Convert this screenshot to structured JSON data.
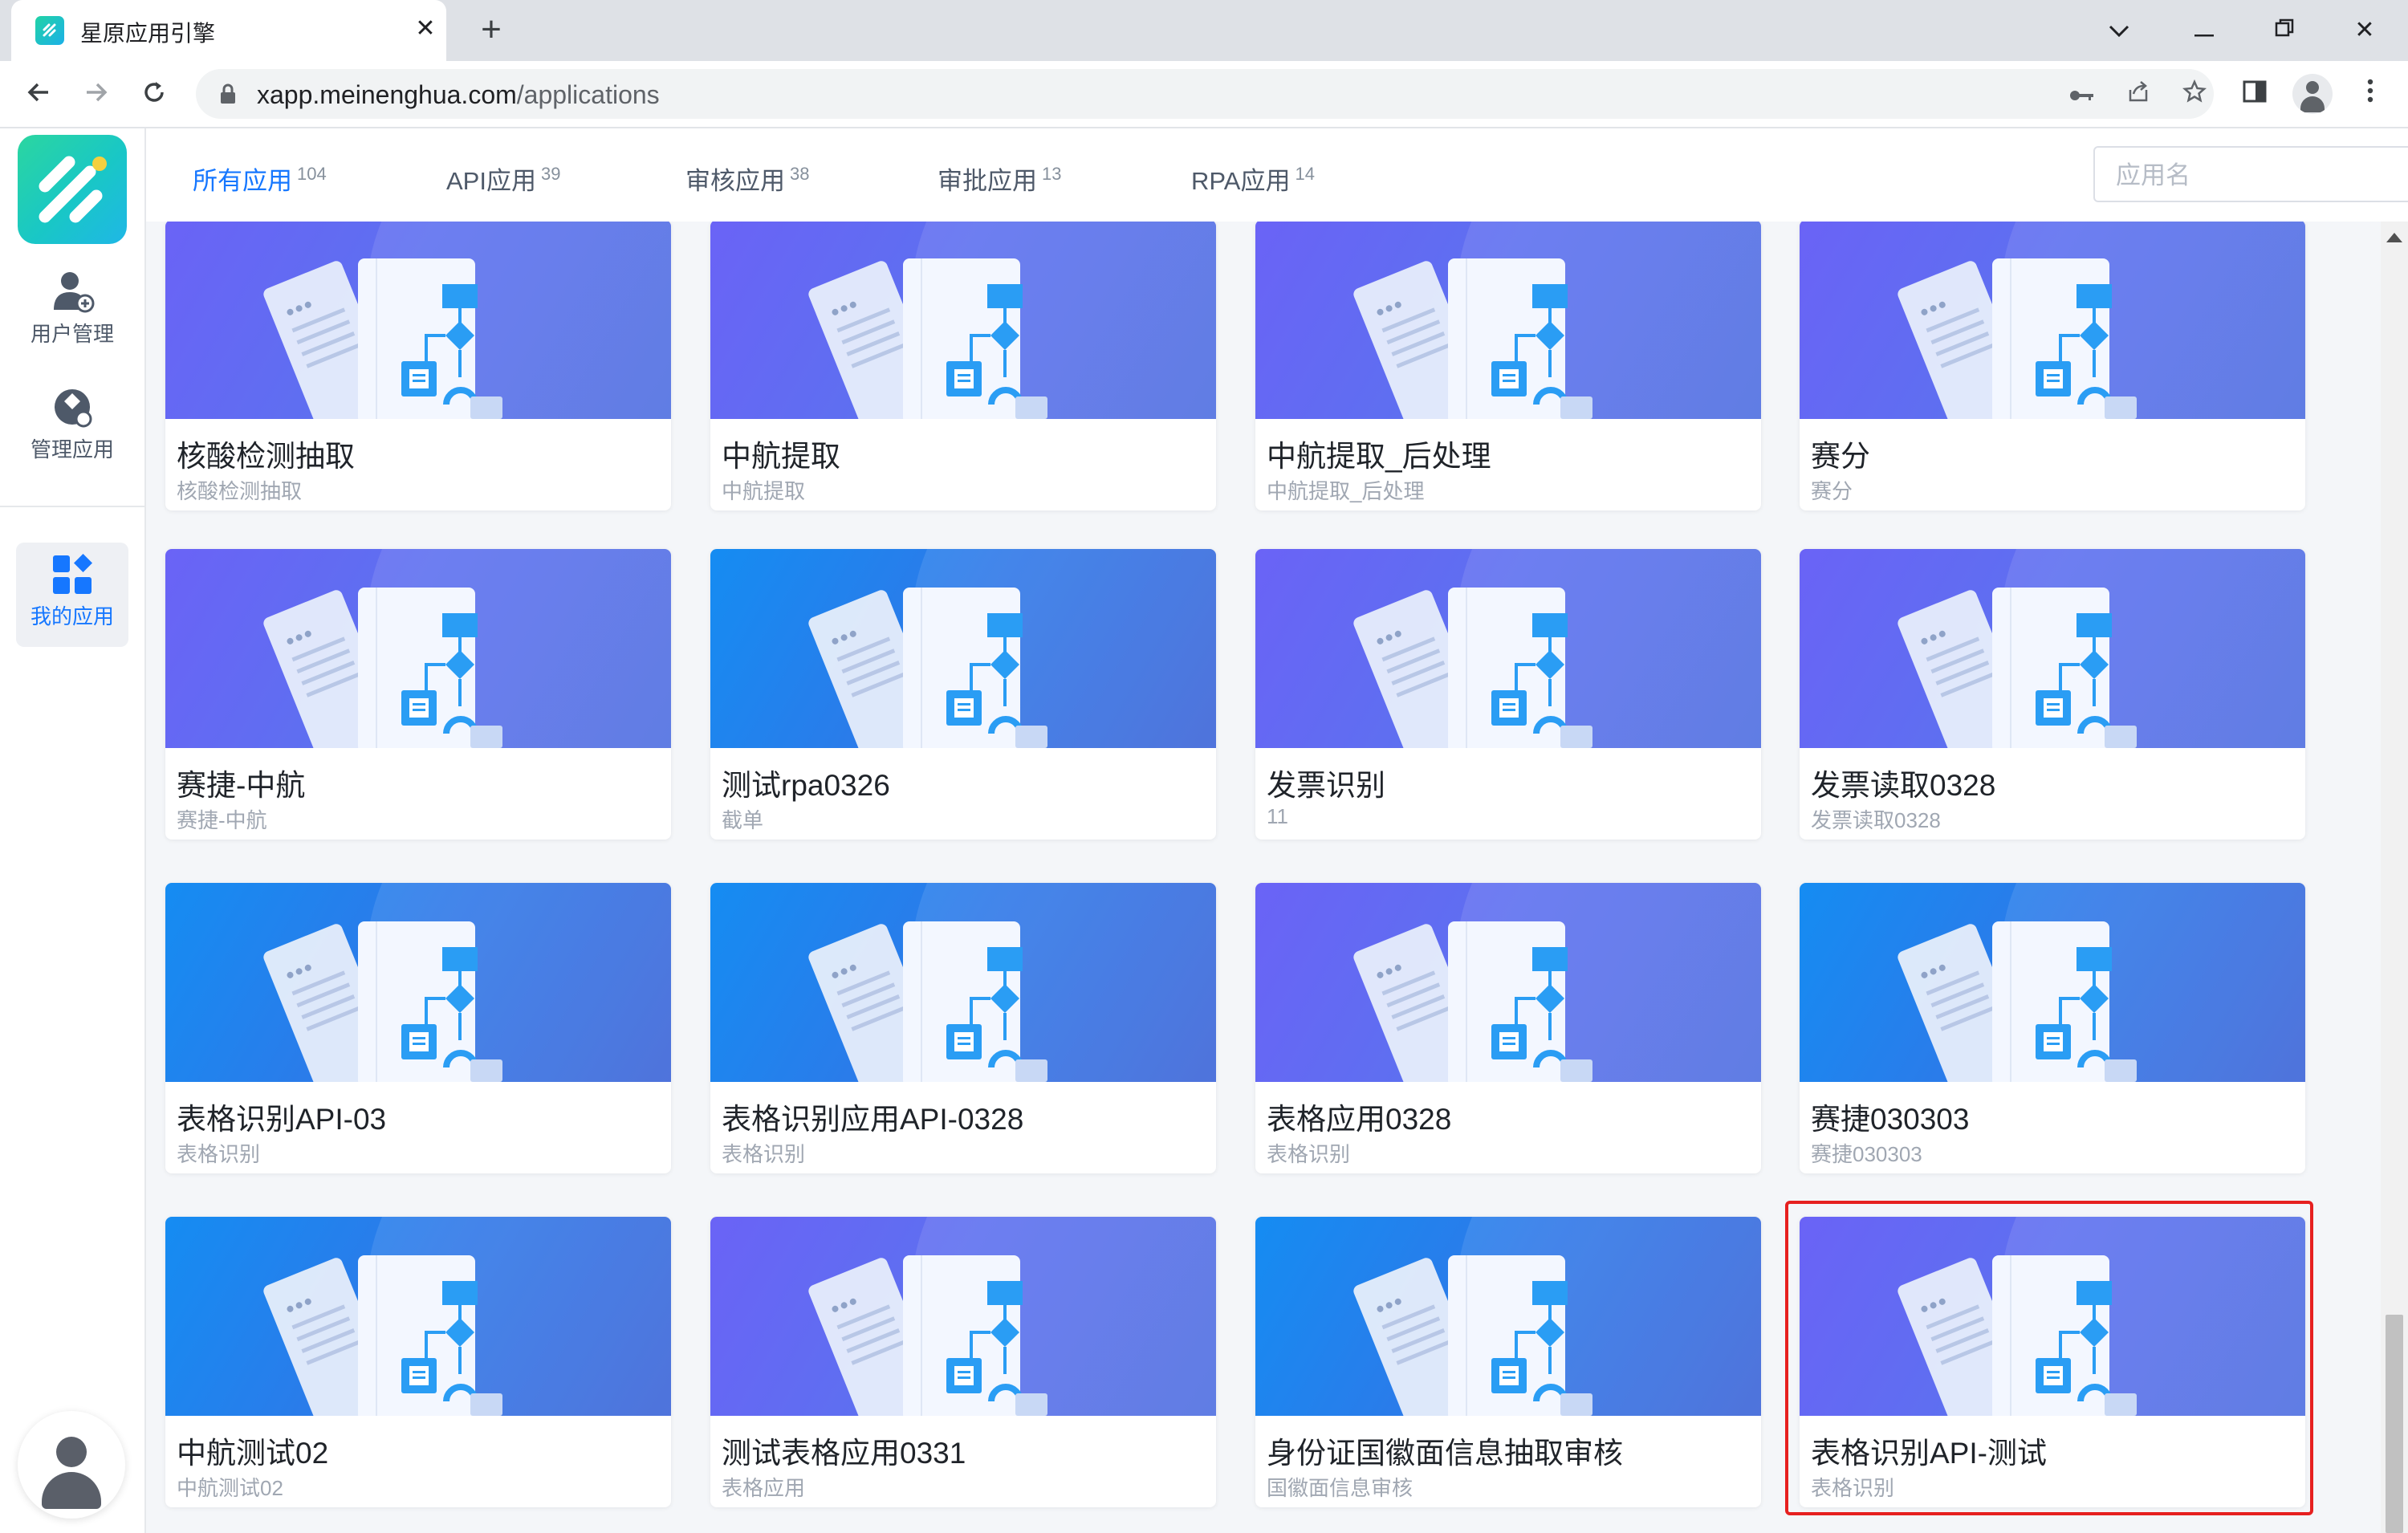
{
  "browser": {
    "tab_title": "星原应用引擎",
    "url_domain": "xapp.meinenghua.com",
    "url_path": "/applications"
  },
  "sidebar": {
    "items": [
      {
        "label": "用户管理",
        "icon": "user-manage-icon"
      },
      {
        "label": "管理应用",
        "icon": "manage-app-icon"
      },
      {
        "label": "我的应用",
        "icon": "my-apps-icon"
      }
    ],
    "active_index": 2,
    "accent": "#1677ff"
  },
  "filters": {
    "tabs": [
      {
        "label": "所有应用",
        "count": "104"
      },
      {
        "label": "API应用",
        "count": "39"
      },
      {
        "label": "审核应用",
        "count": "38"
      },
      {
        "label": "审批应用",
        "count": "13"
      },
      {
        "label": "RPA应用",
        "count": "14"
      }
    ],
    "active_index": 0,
    "search_placeholder": "应用名"
  },
  "apps": [
    {
      "title": "核酸检测抽取",
      "desc": "核酸检测抽取",
      "theme": "purple"
    },
    {
      "title": "中航提取",
      "desc": "中航提取",
      "theme": "purple"
    },
    {
      "title": "中航提取_后处理",
      "desc": "中航提取_后处理",
      "theme": "purple"
    },
    {
      "title": "赛分",
      "desc": "赛分",
      "theme": "purple"
    },
    {
      "title": "赛捷-中航",
      "desc": "赛捷-中航",
      "theme": "purple"
    },
    {
      "title": "测试rpa0326",
      "desc": "截单",
      "theme": "blue"
    },
    {
      "title": "发票识别",
      "desc": "11",
      "theme": "purple"
    },
    {
      "title": "发票读取0328",
      "desc": "发票读取0328",
      "theme": "purple"
    },
    {
      "title": "表格识别API-03",
      "desc": "表格识别",
      "theme": "blue"
    },
    {
      "title": "表格识别应用API-0328",
      "desc": "表格识别",
      "theme": "blue"
    },
    {
      "title": "表格应用0328",
      "desc": "表格识别",
      "theme": "purple"
    },
    {
      "title": "赛捷030303",
      "desc": "赛捷030303",
      "theme": "blue"
    },
    {
      "title": "中航测试02",
      "desc": "中航测试02",
      "theme": "blue"
    },
    {
      "title": "测试表格应用0331",
      "desc": "表格应用",
      "theme": "purple"
    },
    {
      "title": "身份证国徽面信息抽取审核",
      "desc": "国徽面信息审核",
      "theme": "blue"
    },
    {
      "title": "表格识别API-测试",
      "desc": "表格识别",
      "theme": "purple"
    }
  ],
  "highlighted_app_index": 15,
  "colors": {
    "accent": "#1677ff",
    "highlight_border": "#e62020",
    "thumb_purple": "#6a63f6",
    "thumb_blue": "#158cf2"
  }
}
